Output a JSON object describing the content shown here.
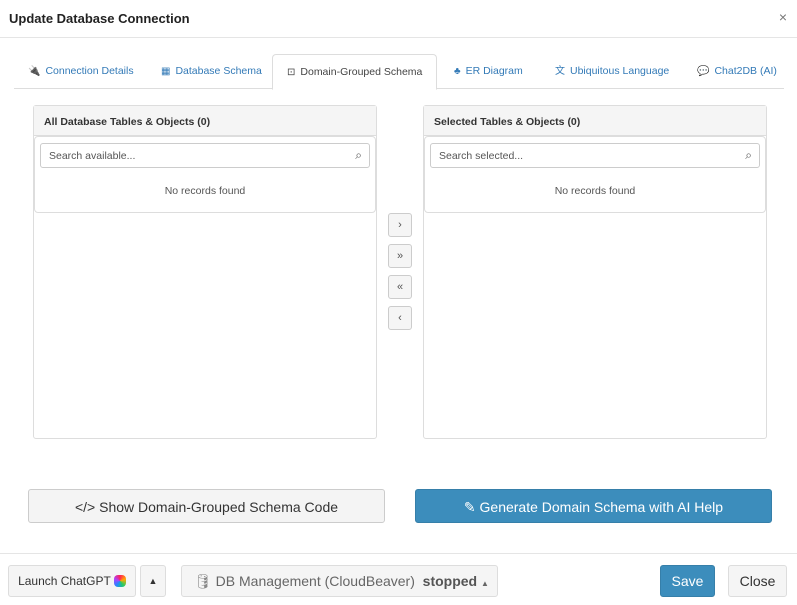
{
  "dialog": {
    "title": "Update Database Connection",
    "close_icon": "×"
  },
  "tabs": [
    {
      "label": "Connection Details",
      "icon": "plug-icon"
    },
    {
      "label": "Database Schema",
      "icon": "table-icon"
    },
    {
      "label": "Domain-Grouped Schema",
      "icon": "object-group-icon",
      "active": true
    },
    {
      "label": "ER Diagram",
      "icon": "sitemap-icon"
    },
    {
      "label": "Ubiquitous Language",
      "icon": "language-icon"
    },
    {
      "label": "Chat2DB (AI)",
      "icon": "comments-icon"
    }
  ],
  "available": {
    "title": "All Database Tables & Objects (0)",
    "placeholder": "Search available...",
    "empty": "No records found"
  },
  "selected": {
    "title": "Selected Tables & Objects (0)",
    "placeholder": "Search selected...",
    "empty": "No records found"
  },
  "move_buttons": {
    "right": "›",
    "all_right": "»",
    "all_left": "«",
    "left": "‹"
  },
  "actions": {
    "show_code": "Show Domain-Grouped Schema Code",
    "generate": "Generate Domain Schema with AI Help"
  },
  "footer": {
    "launch": "Launch ChatGPT",
    "db_management": "DB Management (CloudBeaver)",
    "status": "stopped",
    "save": "Save",
    "close": "Close"
  },
  "colors": {
    "primary": "#3c8dbc",
    "link": "#337ab7"
  }
}
